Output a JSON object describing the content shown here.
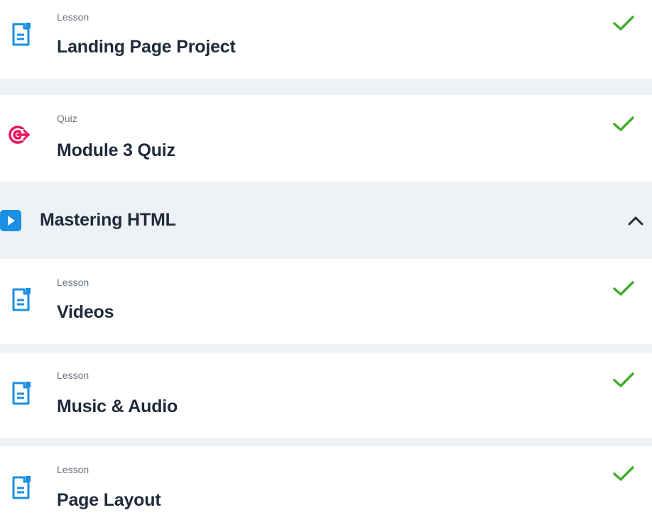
{
  "colors": {
    "page_background": "#eef2f6",
    "card_background": "#ffffff",
    "lesson_icon": "#1a8fe3",
    "quiz_icon": "#e8145c",
    "check": "#3fae2a",
    "title_text": "#1f2a3a",
    "type_text": "#6b7482"
  },
  "items": [
    {
      "type": "Lesson",
      "title": "Landing Page Project",
      "icon": "document-icon",
      "completed": true
    },
    {
      "type": "Quiz",
      "title": "Module 3 Quiz",
      "icon": "target-icon",
      "completed": true
    },
    {
      "type": "Lesson",
      "title": "Videos",
      "icon": "document-icon",
      "completed": true
    },
    {
      "type": "Lesson",
      "title": "Music & Audio",
      "icon": "document-icon",
      "completed": true
    },
    {
      "type": "Lesson",
      "title": "Page Layout",
      "icon": "document-icon",
      "completed": true
    }
  ],
  "section": {
    "title": "Mastering HTML",
    "icon": "play-icon",
    "expanded": true,
    "toggle_icon": "chevron-up-icon"
  }
}
